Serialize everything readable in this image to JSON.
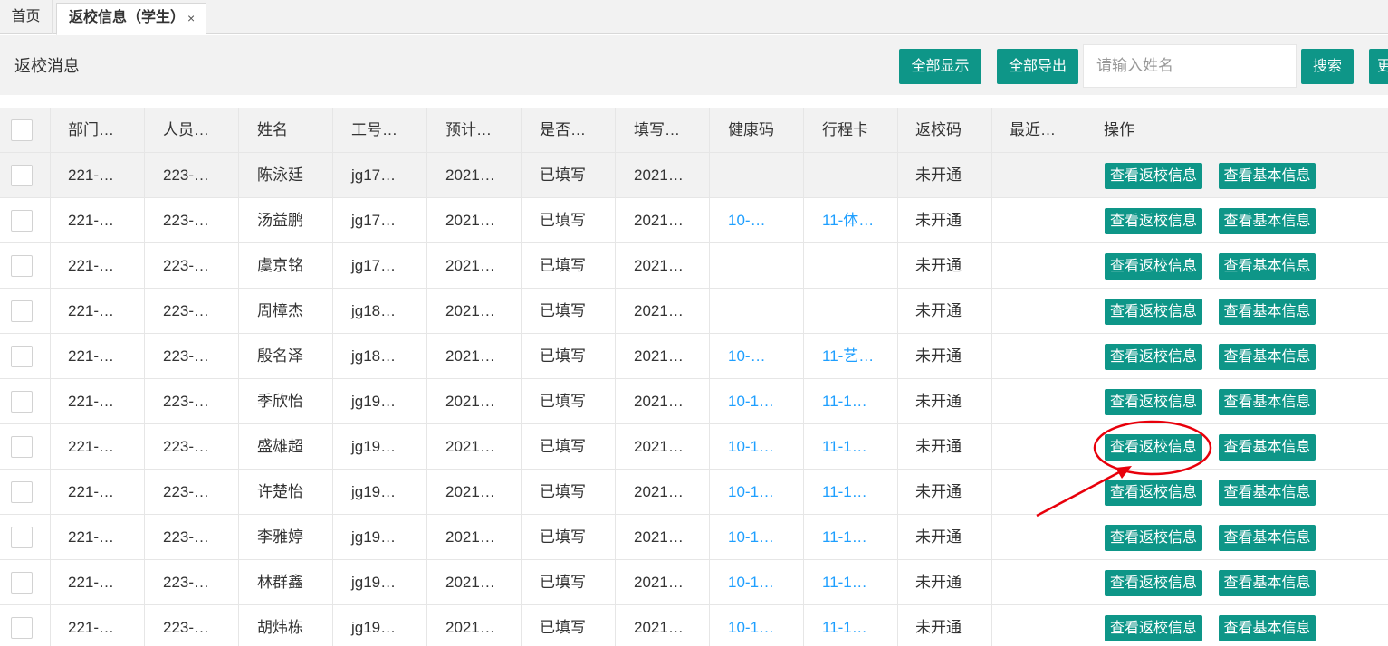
{
  "tabs": {
    "home_label": "首页",
    "active_label": "返校信息（学生）",
    "close_glyph": "×"
  },
  "toolbar": {
    "title": "返校消息",
    "show_all_label": "全部显示",
    "export_all_label": "全部导出",
    "search_placeholder": "请输入姓名",
    "search_label": "搜索",
    "more_label": "更"
  },
  "table": {
    "headers": [
      "部门…",
      "人员…",
      "姓名",
      "工号…",
      "预计…",
      "是否…",
      "填写…",
      "健康码",
      "行程卡",
      "返校码",
      "最近…",
      "操作"
    ],
    "action_labels": {
      "return_info": "查看返校信息",
      "basic_info": "查看基本信息"
    },
    "rows": [
      {
        "dept": "221-…",
        "person": "223-…",
        "name": "陈泳廷",
        "id": "jg17…",
        "expected": "2021…",
        "filled": "已填写",
        "fill_time": "2021…",
        "health": "",
        "trip": "",
        "return_code": "未开通",
        "recent": ""
      },
      {
        "dept": "221-…",
        "person": "223-…",
        "name": "汤益鹏",
        "id": "jg17…",
        "expected": "2021…",
        "filled": "已填写",
        "fill_time": "2021…",
        "health": "10-…",
        "trip": "11-体…",
        "return_code": "未开通",
        "recent": ""
      },
      {
        "dept": "221-…",
        "person": "223-…",
        "name": "虞京铭",
        "id": "jg17…",
        "expected": "2021…",
        "filled": "已填写",
        "fill_time": "2021…",
        "health": "",
        "trip": "",
        "return_code": "未开通",
        "recent": ""
      },
      {
        "dept": "221-…",
        "person": "223-…",
        "name": "周樟杰",
        "id": "jg18…",
        "expected": "2021…",
        "filled": "已填写",
        "fill_time": "2021…",
        "health": "",
        "trip": "",
        "return_code": "未开通",
        "recent": ""
      },
      {
        "dept": "221-…",
        "person": "223-…",
        "name": "殷名泽",
        "id": "jg18…",
        "expected": "2021…",
        "filled": "已填写",
        "fill_time": "2021…",
        "health": "10-…",
        "trip": "11-艺…",
        "return_code": "未开通",
        "recent": ""
      },
      {
        "dept": "221-…",
        "person": "223-…",
        "name": "季欣怡",
        "id": "jg19…",
        "expected": "2021…",
        "filled": "已填写",
        "fill_time": "2021…",
        "health": "10-1…",
        "trip": "11-1…",
        "return_code": "未开通",
        "recent": ""
      },
      {
        "dept": "221-…",
        "person": "223-…",
        "name": "盛雄超",
        "id": "jg19…",
        "expected": "2021…",
        "filled": "已填写",
        "fill_time": "2021…",
        "health": "10-1…",
        "trip": "11-1…",
        "return_code": "未开通",
        "recent": ""
      },
      {
        "dept": "221-…",
        "person": "223-…",
        "name": "许楚怡",
        "id": "jg19…",
        "expected": "2021…",
        "filled": "已填写",
        "fill_time": "2021…",
        "health": "10-1…",
        "trip": "11-1…",
        "return_code": "未开通",
        "recent": ""
      },
      {
        "dept": "221-…",
        "person": "223-…",
        "name": "李雅婷",
        "id": "jg19…",
        "expected": "2021…",
        "filled": "已填写",
        "fill_time": "2021…",
        "health": "10-1…",
        "trip": "11-1…",
        "return_code": "未开通",
        "recent": ""
      },
      {
        "dept": "221-…",
        "person": "223-…",
        "name": "林群鑫",
        "id": "jg19…",
        "expected": "2021…",
        "filled": "已填写",
        "fill_time": "2021…",
        "health": "10-1…",
        "trip": "11-1…",
        "return_code": "未开通",
        "recent": ""
      },
      {
        "dept": "221-…",
        "person": "223-…",
        "name": "胡炜栋",
        "id": "jg19…",
        "expected": "2021…",
        "filled": "已填写",
        "fill_time": "2021…",
        "health": "10-1…",
        "trip": "11-1…",
        "return_code": "未开通",
        "recent": ""
      }
    ]
  },
  "colors": {
    "accent_green": "#0e9688",
    "link_blue": "#1e9fff",
    "annotation_red": "#e8000b"
  },
  "annotation": {
    "highlighted_row_index": 6,
    "icon": "red-circle-and-arrow"
  }
}
